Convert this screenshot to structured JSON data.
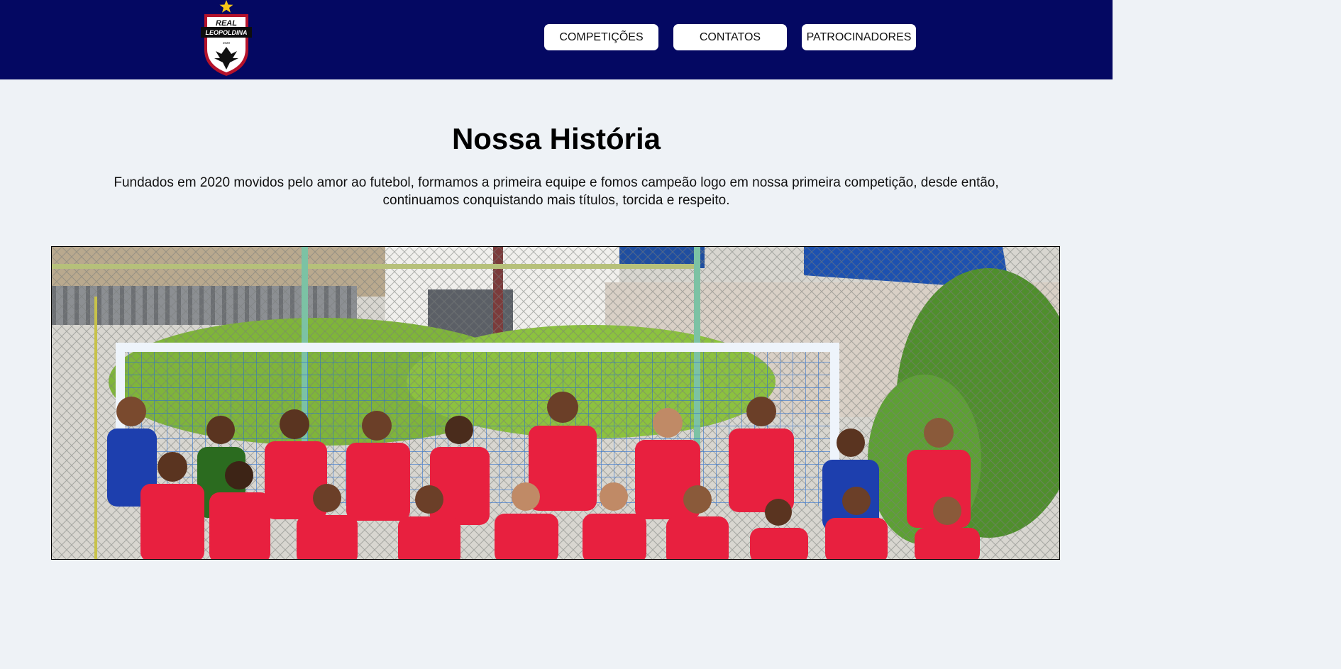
{
  "header": {
    "logo": {
      "line1": "REAL",
      "line2": "LEOPOLDINA",
      "year": "2020"
    },
    "nav": [
      {
        "label": "COMPETIÇÕES"
      },
      {
        "label": "CONTATOS"
      },
      {
        "label": "PATROCINADORES"
      }
    ]
  },
  "main": {
    "title": "Nossa História",
    "intro_line1": "Fundados em 2020 movidos pelo amor ao futebol, formamos a primeira equipe e fomos campeão logo em nossa primeira competição, desde então,",
    "intro_line2": "continuamos conquistando mais títulos, torcida e respeito."
  },
  "colors": {
    "header_bg": "#040862",
    "page_bg": "#eef2f6",
    "jersey_red": "#e8203f",
    "jersey_blue": "#1d3fae"
  }
}
